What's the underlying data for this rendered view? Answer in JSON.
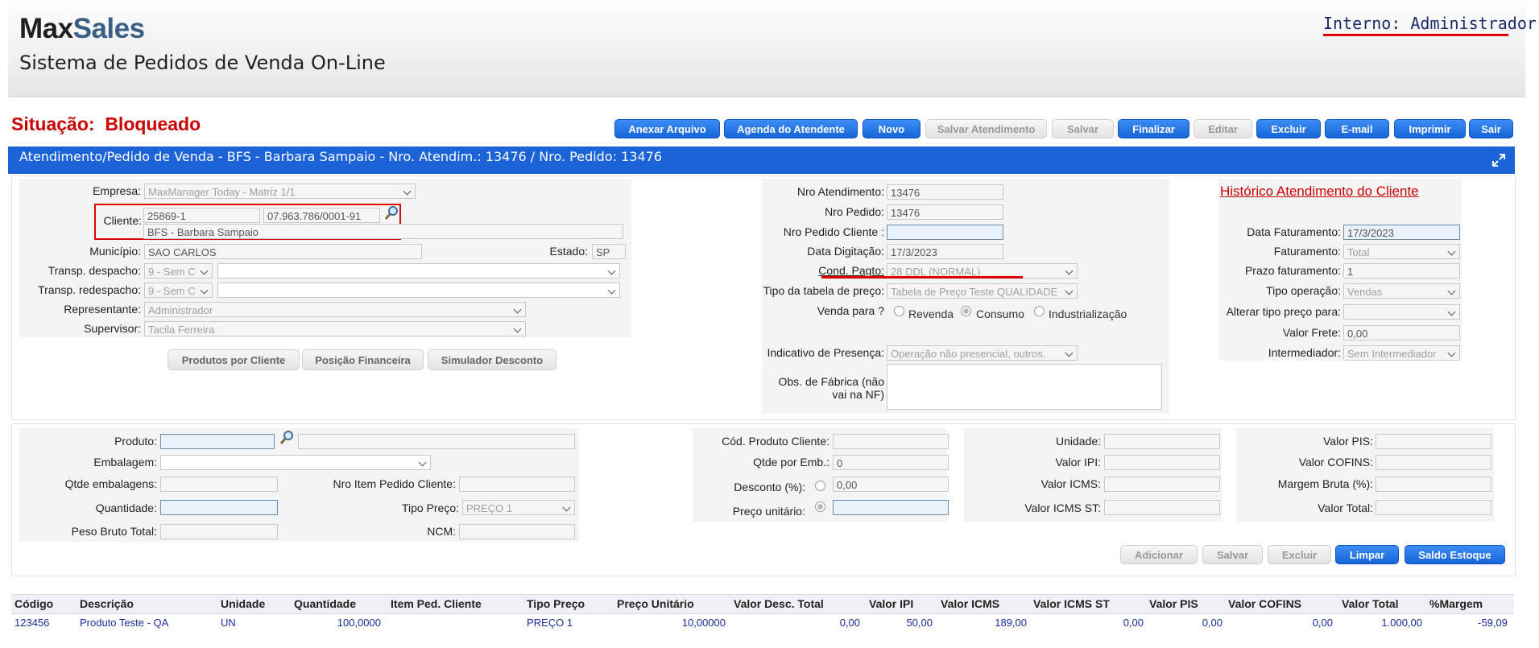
{
  "header": {
    "logo_max": "Max",
    "logo_sales": "Sales",
    "subtitle": "Sistema de Pedidos de Venda On-Line",
    "user": "Interno: Administrador"
  },
  "status": {
    "label": "Situação:",
    "value": "Bloqueado"
  },
  "toolbar": {
    "anexar": "Anexar Arquivo",
    "agenda": "Agenda do Atendente",
    "novo": "Novo",
    "salvar_atendimento": "Salvar Atendimento",
    "salvar": "Salvar",
    "finalizar": "Finalizar",
    "editar": "Editar",
    "excluir": "Excluir",
    "email": "E-mail",
    "imprimir": "Imprimir",
    "sair": "Sair"
  },
  "titlebar": {
    "text": "Atendimento/Pedido de Venda - BFS - Barbara Sampaio - Nro. Atendim.: 13476 / Nro. Pedido: 13476"
  },
  "left": {
    "empresa_label": "Empresa:",
    "empresa_value": "MaxManager Today - Matriz 1/1",
    "cliente_label": "Cliente:",
    "cliente_code": "25869-1",
    "cliente_cnpj": "07.963.786/0001-91",
    "cliente_name": "BFS - Barbara Sampaio",
    "municipio_label": "Município:",
    "municipio_value": "SAO CARLOS",
    "estado_label": "Estado:",
    "estado_value": "SP",
    "transp_desp_label": "Transp. despacho:",
    "transp_desp_value": "9 - Sem C",
    "transp_redesp_label": "Transp. redespacho:",
    "transp_redesp_value": "9 - Sem C",
    "representante_label": "Representante:",
    "representante_value": "Administrador",
    "supervisor_label": "Supervisor:",
    "supervisor_value": "Tacila Ferreira",
    "btn_produtos": "Produtos por Cliente",
    "btn_posicao": "Posição Financeira",
    "btn_simulador": "Simulador Desconto"
  },
  "middle": {
    "nro_atend_label": "Nro Atendimento:",
    "nro_atend_value": "13476",
    "nro_pedido_label": "Nro Pedido:",
    "nro_pedido_value": "13476",
    "nro_ped_cli_label": "Nro Pedido Cliente :",
    "nro_ped_cli_value": "",
    "data_dig_label": "Data Digitação:",
    "data_dig_value": "17/3/2023",
    "cond_pagto_label": "Cond. Pagto:",
    "cond_pagto_value": "28 DDL (NORMAL)",
    "tipo_tabela_label": "Tipo da tabela de preço:",
    "tipo_tabela_value": "Tabela de Preço Teste QUALIDADE",
    "venda_para_label": "Venda para ?",
    "opt_revenda": "Revenda",
    "opt_consumo": "Consumo",
    "opt_industrializacao": "Industrialização",
    "indicativo_label": "Indicativo de Presença:",
    "indicativo_value": "Operação não presencial, outros.",
    "obs_label_1": "Obs. de Fábrica (não",
    "obs_label_2": "vai na NF)"
  },
  "right": {
    "historico": "Histórico Atendimento do Cliente",
    "data_fat_label": "Data Faturamento:",
    "data_fat_value": "17/3/2023",
    "faturamento_label": "Faturamento:",
    "faturamento_value": "Total",
    "prazo_label": "Prazo faturamento:",
    "prazo_value": "1",
    "tipo_op_label": "Tipo operação:",
    "tipo_op_value": "Vendas",
    "alterar_label": "Alterar tipo preço para:",
    "alterar_value": "",
    "frete_label": "Valor Frete:",
    "frete_value": "0,00",
    "intermediador_label": "Intermediador:",
    "intermediador_value": "Sem Intermediador"
  },
  "item": {
    "produto_label": "Produto:",
    "embalagem_label": "Embalagem:",
    "qtde_emb_label": "Qtde embalagens:",
    "nro_item_label": "Nro Item Pedido Cliente:",
    "quantidade_label": "Quantidade:",
    "tipo_preco_label": "Tipo Preço:",
    "tipo_preco_value": "PREÇO 1",
    "peso_label": "Peso Bruto Total:",
    "ncm_label": "NCM:",
    "cod_prod_cli_label": "Cód. Produto Cliente:",
    "qtde_por_emb_label": "Qtde por Emb.:",
    "qtde_por_emb_value": "0",
    "desconto_label": "Desconto (%):",
    "desconto_value": "0,00",
    "preco_unit_label": "Preço unitário:",
    "unidade_label": "Unidade:",
    "valor_ipi_label": "Valor IPI:",
    "valor_icms_label": "Valor ICMS:",
    "valor_icms_st_label": "Valor ICMS ST:",
    "valor_pis_label": "Valor PIS:",
    "valor_cofins_label": "Valor COFINS:",
    "margem_label": "Margem Bruta (%):",
    "valor_total_label": "Valor Total:",
    "btn_adicionar": "Adicionar",
    "btn_salvar": "Salvar",
    "btn_excluir": "Excluir",
    "btn_limpar": "Limpar",
    "btn_saldo": "Saldo Estoque"
  },
  "grid": {
    "headers": [
      "Código",
      "Descrição",
      "Unidade",
      "Quantidade",
      "Item Ped. Cliente",
      "Tipo Preço",
      "Preço Unitário",
      "Valor Desc. Total",
      "Valor IPI",
      "Valor ICMS",
      "Valor ICMS ST",
      "Valor PIS",
      "Valor COFINS",
      "Valor Total",
      "%Margem"
    ],
    "row": [
      "123456",
      "Produto Teste - QA",
      "UN",
      "100,0000",
      "",
      "PREÇO 1",
      "10,00000",
      "0,00",
      "50,00",
      "189,00",
      "0,00",
      "0,00",
      "0,00",
      "1.000,00",
      "-59,09"
    ]
  },
  "colors": {
    "accent": "#1b63d6",
    "status": "#cc0000",
    "highlight": "#dd0000"
  }
}
